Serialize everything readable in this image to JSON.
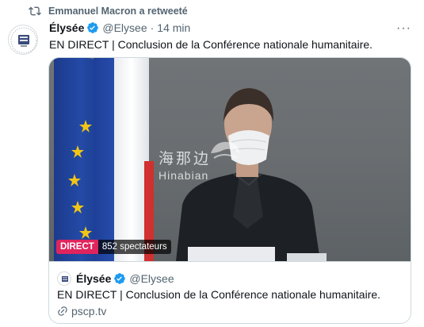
{
  "retweet": {
    "label": "Emmanuel Macron a retweeté"
  },
  "tweet": {
    "name": "Élysée",
    "handle": "@Elysee",
    "separator": "·",
    "time": "14 min",
    "more": "···",
    "text": "EN DIRECT | Conclusion de la Conférence nationale humanitaire."
  },
  "video": {
    "live_label": "DIRECT",
    "viewers": "852 spectateurs",
    "watermark_cn": "海那边",
    "watermark_en": "Hinabian"
  },
  "quote": {
    "name": "Élysée",
    "handle": "@Elysee",
    "text": "EN DIRECT | Conclusion de la Conférence nationale humanitaire.",
    "link": "pscp.tv"
  },
  "colors": {
    "verified": "#1d9bf0",
    "live": "#e0245e",
    "secondary_text": "#536471"
  },
  "icons": [
    "retweet-icon",
    "verified-icon",
    "more-icon",
    "link-icon"
  ]
}
